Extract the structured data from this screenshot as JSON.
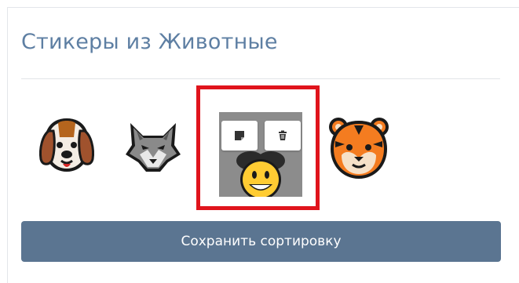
{
  "title": "Стикеры из Животные",
  "save_button_label": "Сохранить сортировку",
  "stickers": [
    {
      "name": "dog",
      "icon": "dog-face-icon"
    },
    {
      "name": "wolf",
      "icon": "wolf-face-icon"
    },
    {
      "name": "selected",
      "icon": "grinning-face-icon",
      "selected": true
    },
    {
      "name": "tiger",
      "icon": "tiger-face-icon"
    }
  ],
  "sticker_tools": [
    {
      "name": "edit",
      "icon": "sticky-note-icon"
    },
    {
      "name": "delete",
      "icon": "trash-icon"
    }
  ],
  "colors": {
    "title": "#5e7fa3",
    "selection_border": "#e0141c",
    "save_button": "#5b7591"
  }
}
